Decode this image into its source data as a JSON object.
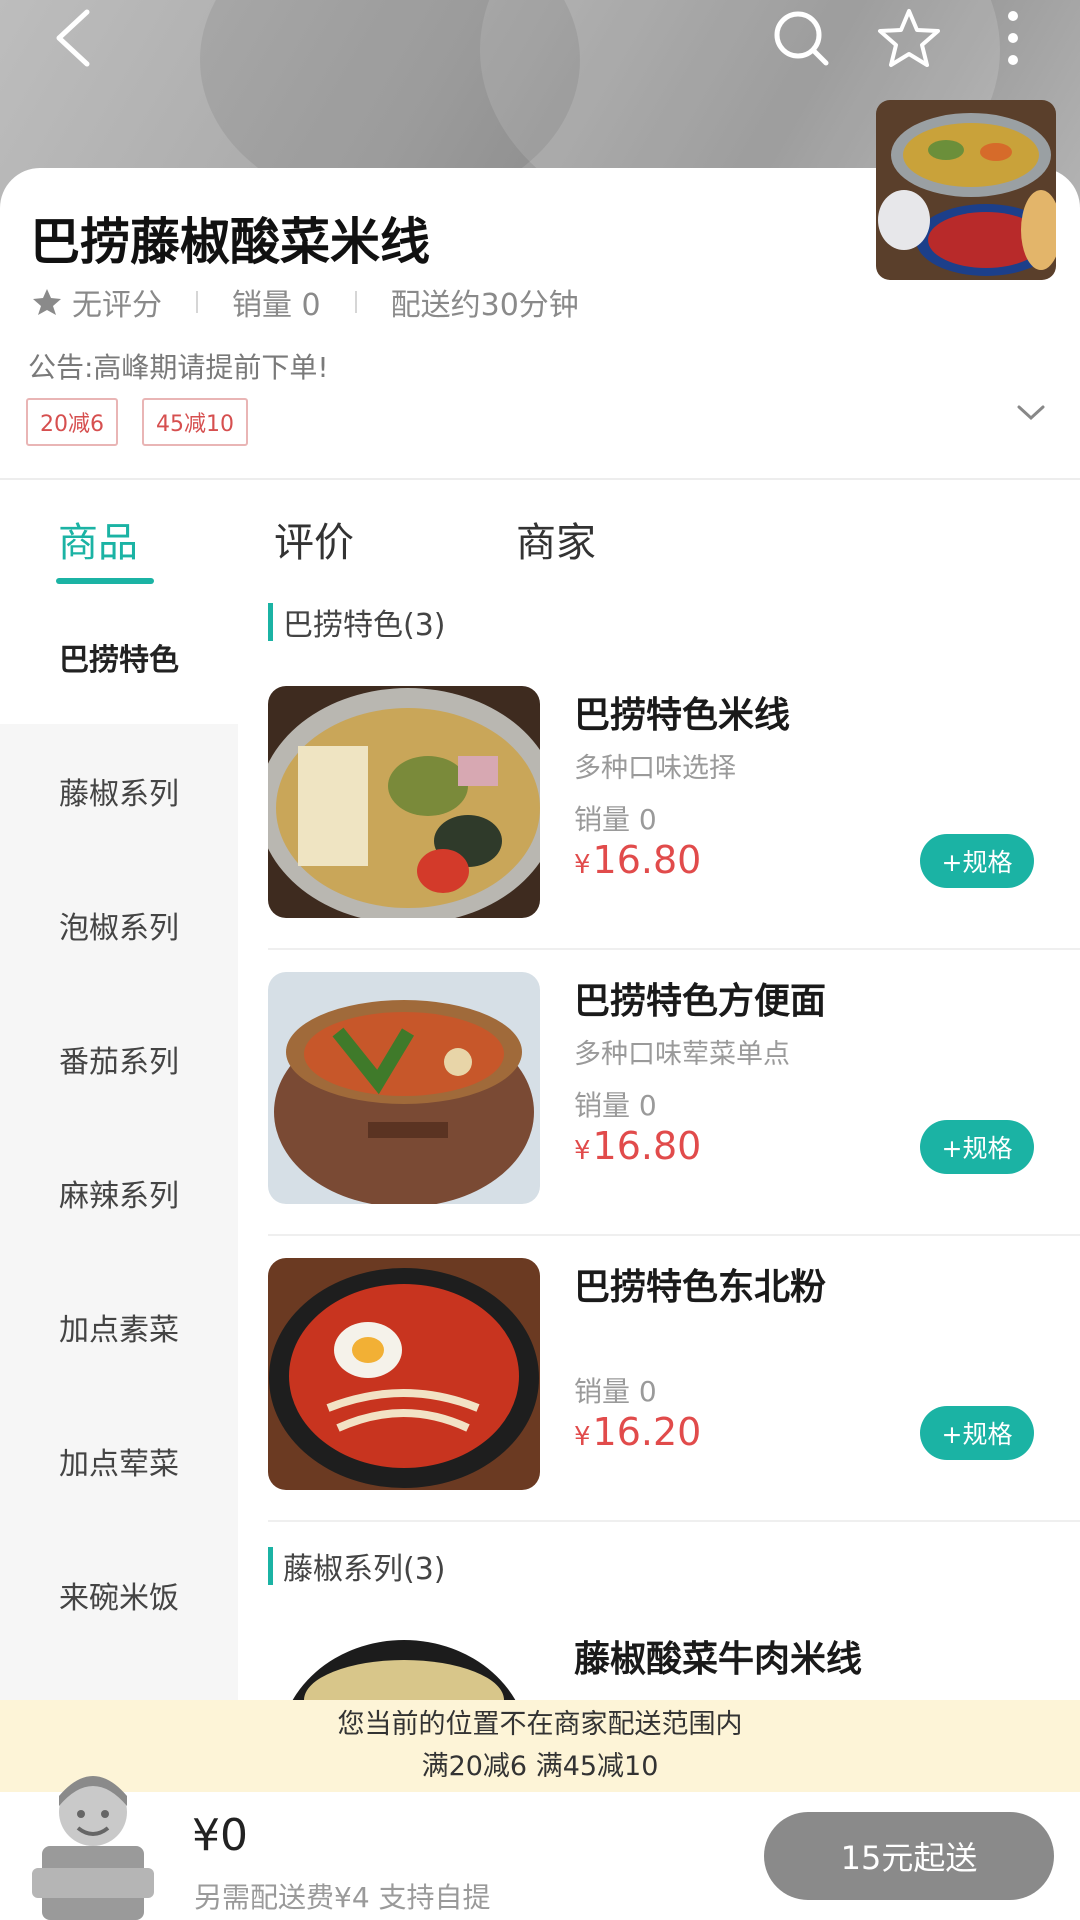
{
  "header": {
    "back_icon": "chevron-left-icon",
    "search_icon": "search-icon",
    "favorite_icon": "star-outline-icon",
    "more_icon": "more-vertical-icon"
  },
  "shop": {
    "name": "巴捞藤椒酸菜米线",
    "rating": "无评分",
    "sales": "销量 0",
    "delivery": "配送约30分钟",
    "notice": "公告:高峰期请提前下单!",
    "promos": [
      "20减6",
      "45减10"
    ]
  },
  "tabs": [
    {
      "label": "商品",
      "active": true
    },
    {
      "label": "评价",
      "active": false
    },
    {
      "label": "商家",
      "active": false
    }
  ],
  "categories": [
    "巴捞特色",
    "藤椒系列",
    "泡椒系列",
    "番茄系列",
    "麻辣系列",
    "加点素菜",
    "加点荤菜",
    "来碗米饭"
  ],
  "sections": [
    {
      "title": "巴捞特色(3)",
      "items": [
        {
          "name": "巴捞特色米线",
          "desc": "多种口味选择",
          "sales": "销量 0",
          "currency": "¥",
          "price": "16.80",
          "spec_label": "+规格"
        },
        {
          "name": "巴捞特色方便面",
          "desc": "多种口味荤菜单点",
          "sales": "销量 0",
          "currency": "¥",
          "price": "16.80",
          "spec_label": "+规格"
        },
        {
          "name": "巴捞特色东北粉",
          "desc": "",
          "sales": "销量 0",
          "currency": "¥",
          "price": "16.20",
          "spec_label": "+规格"
        }
      ]
    },
    {
      "title": "藤椒系列(3)",
      "items": [
        {
          "name": "藤椒酸菜牛肉米线",
          "desc": "",
          "sales": "",
          "currency": "",
          "price": "",
          "spec_label": ""
        }
      ]
    }
  ],
  "banner": {
    "line1": "您当前的位置不在商家配送范围内",
    "line2": "满20减6  满45减10"
  },
  "cart": {
    "total": "¥0",
    "fee_note": "另需配送费¥4  支持自提",
    "checkout_label": "15元起送"
  },
  "colors": {
    "accent": "#1bb3a4",
    "price": "#e14b4b",
    "checkout_disabled": "#8a8a8a",
    "banner_bg": "#fdf4d7"
  }
}
